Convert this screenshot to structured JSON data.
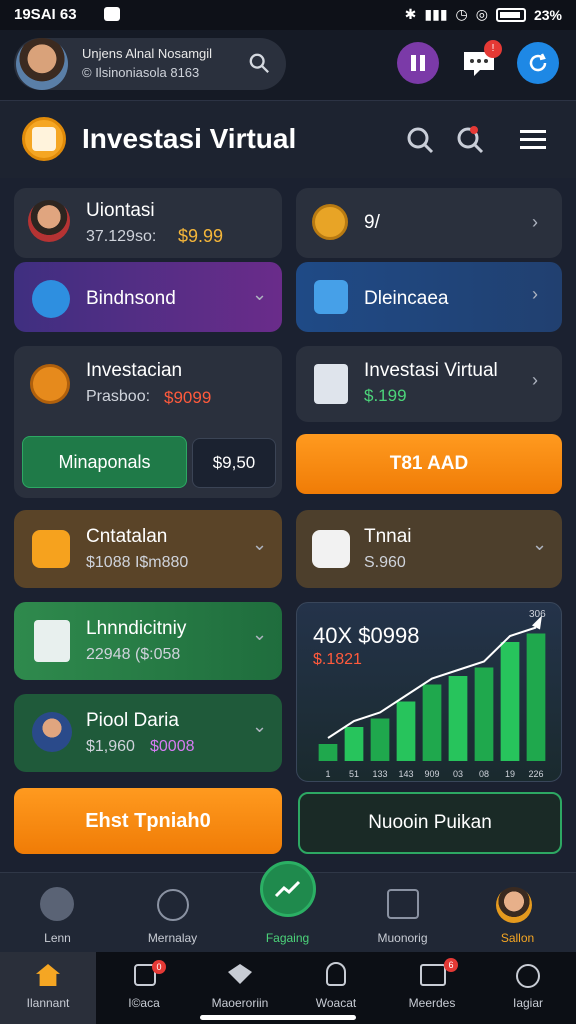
{
  "status_bar": {
    "time": "19SAI 63",
    "battery": "23%"
  },
  "profile": {
    "name": "Unjens Alnal Nosamgil",
    "subtitle": "© Ilsinoniasola 8163"
  },
  "top_actions": {
    "chat_badge": "!"
  },
  "header": {
    "title": "Investasi Virtual"
  },
  "cards": {
    "c1": {
      "title": "Uiontasi",
      "sub": "37.129so:",
      "value": "$9.99"
    },
    "c2": {
      "title": "9/"
    },
    "c3": {
      "title": "Bindnsond"
    },
    "c4": {
      "title": "Dleincaea"
    },
    "c5": {
      "title": "Investacian",
      "sub": "Prasboo:",
      "value": "$9099"
    },
    "c6": {
      "title": "Investasi Virtual",
      "value": "$.199"
    },
    "btn_green": "Minaponals",
    "amount_box": "$9,50",
    "btn_orange1": "T81 AAD",
    "c7": {
      "title": "Cntatalan",
      "sub": "$1088 I$m880"
    },
    "c8": {
      "title": "Tnnai",
      "sub": "S.960"
    },
    "c9": {
      "title": "Lhnndicitniy",
      "sub": "22948 ($:058"
    },
    "c10": {
      "title": "Piool Daria",
      "sub": "$1,960",
      "value": "$0008"
    },
    "btn_orange2": "Ehst Tpniah0",
    "btn_outline": "Nuooin Puikan"
  },
  "chart_data": {
    "type": "bar",
    "title": "40X $0998",
    "subtitle": "$.1821",
    "corner_label": "306",
    "categories": [
      "1",
      "51",
      "133",
      "143",
      "909",
      "03",
      "08",
      "19",
      "226"
    ],
    "values": [
      2,
      4,
      5,
      7,
      9,
      10,
      11,
      14,
      15
    ],
    "ylim": [
      0,
      16
    ]
  },
  "nav1": [
    "Lenn",
    "Mernalay",
    "Fagaing",
    "Muonorig",
    "Sallon"
  ],
  "nav2": [
    "Ilannant",
    "I©aca",
    "Maoeroriin",
    "Woacat",
    "Meerdes",
    "Iagiar"
  ],
  "nav2_badges": [
    "",
    "0",
    "",
    "",
    "6",
    ""
  ]
}
